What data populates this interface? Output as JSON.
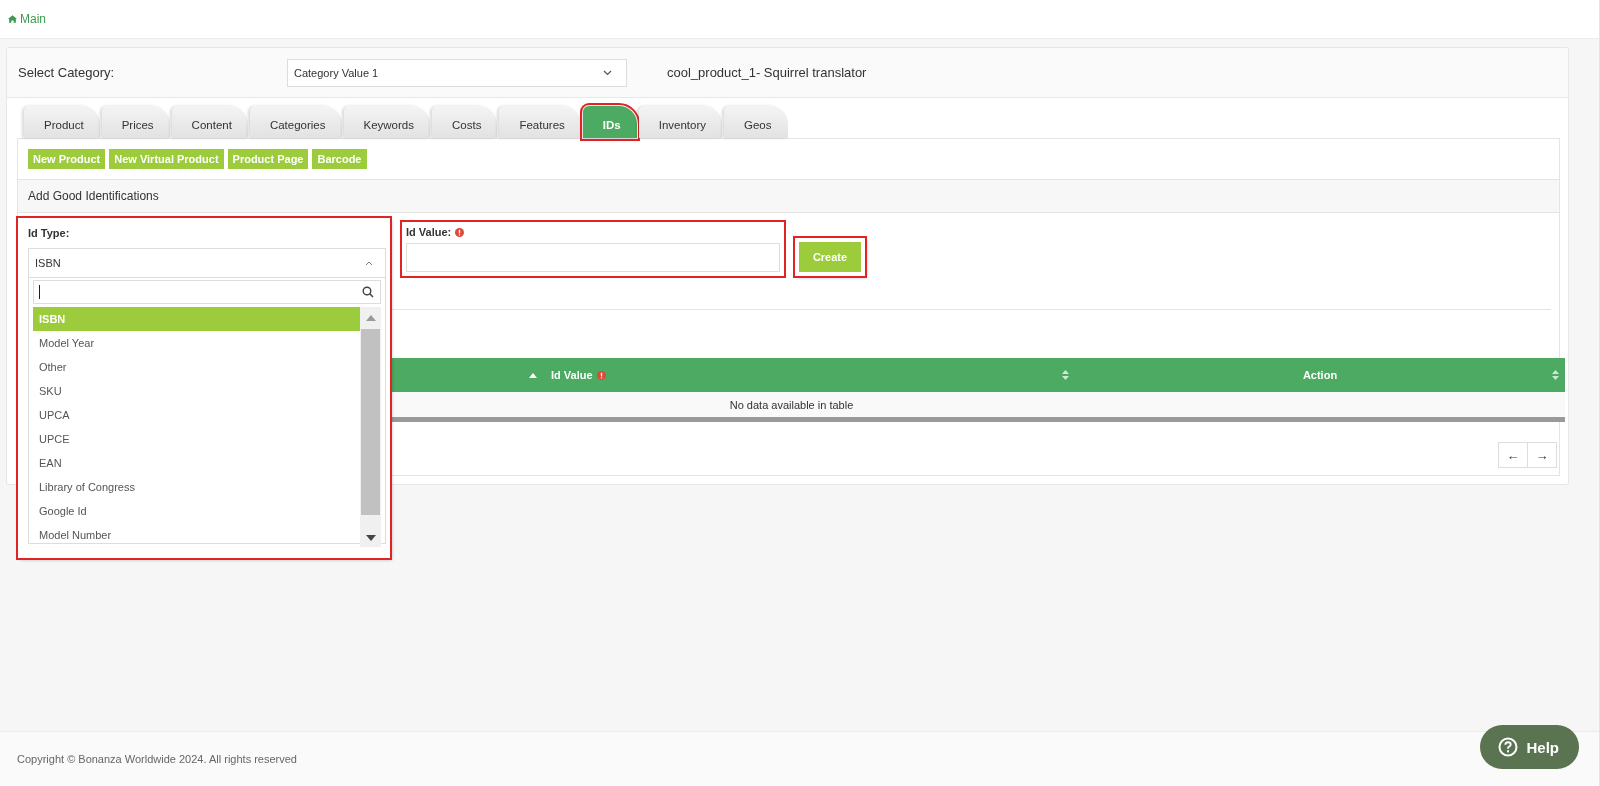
{
  "breadcrumb": {
    "label": "Main"
  },
  "category": {
    "label": "Select Category:",
    "value": "Category Value 1",
    "product_title": "cool_product_1- Squirrel translator"
  },
  "tabs": [
    {
      "label": "Product",
      "selected": false,
      "highlighted": false
    },
    {
      "label": "Prices",
      "selected": false,
      "highlighted": false
    },
    {
      "label": "Content",
      "selected": false,
      "highlighted": false
    },
    {
      "label": "Categories",
      "selected": false,
      "highlighted": false
    },
    {
      "label": "Keywords",
      "selected": false,
      "highlighted": false
    },
    {
      "label": "Costs",
      "selected": false,
      "highlighted": false
    },
    {
      "label": "Features",
      "selected": false,
      "highlighted": false
    },
    {
      "label": "IDs",
      "selected": true,
      "highlighted": true
    },
    {
      "label": "Inventory",
      "selected": false,
      "highlighted": false
    },
    {
      "label": "Geos",
      "selected": false,
      "highlighted": false
    }
  ],
  "actions": [
    "New Product",
    "New Virtual Product",
    "Product Page",
    "Barcode"
  ],
  "section_title": "Add Good Identifications",
  "id_type": {
    "label": "Id Type:",
    "value": "ISBN",
    "expanded": true,
    "highlighted": true,
    "options": [
      {
        "label": "ISBN",
        "selected": true
      },
      {
        "label": "Model Year",
        "selected": false
      },
      {
        "label": "Other",
        "selected": false
      },
      {
        "label": "SKU",
        "selected": false
      },
      {
        "label": "UPCA",
        "selected": false
      },
      {
        "label": "UPCE",
        "selected": false
      },
      {
        "label": "EAN",
        "selected": false
      },
      {
        "label": "Library of Congress",
        "selected": false
      },
      {
        "label": "Google Id",
        "selected": false
      },
      {
        "label": "Model Number",
        "selected": false
      }
    ]
  },
  "id_value": {
    "label": "Id Value:",
    "required": true,
    "highlighted": true
  },
  "create_button": {
    "label": "Create",
    "highlighted": true
  },
  "table": {
    "columns": [
      {
        "sorted_ascending": true
      },
      {
        "label": "Id Value",
        "sorted_ascending": false,
        "info": true
      },
      {
        "label": "Action",
        "sorted_ascending": false,
        "info": false
      }
    ],
    "empty_text": "No data available in table"
  },
  "pager": [
    "←",
    "→"
  ],
  "footer": {
    "copyright": "Copyright © Bonanza Worldwide 2024. All rights reserved"
  },
  "help": {
    "label": "Help"
  }
}
